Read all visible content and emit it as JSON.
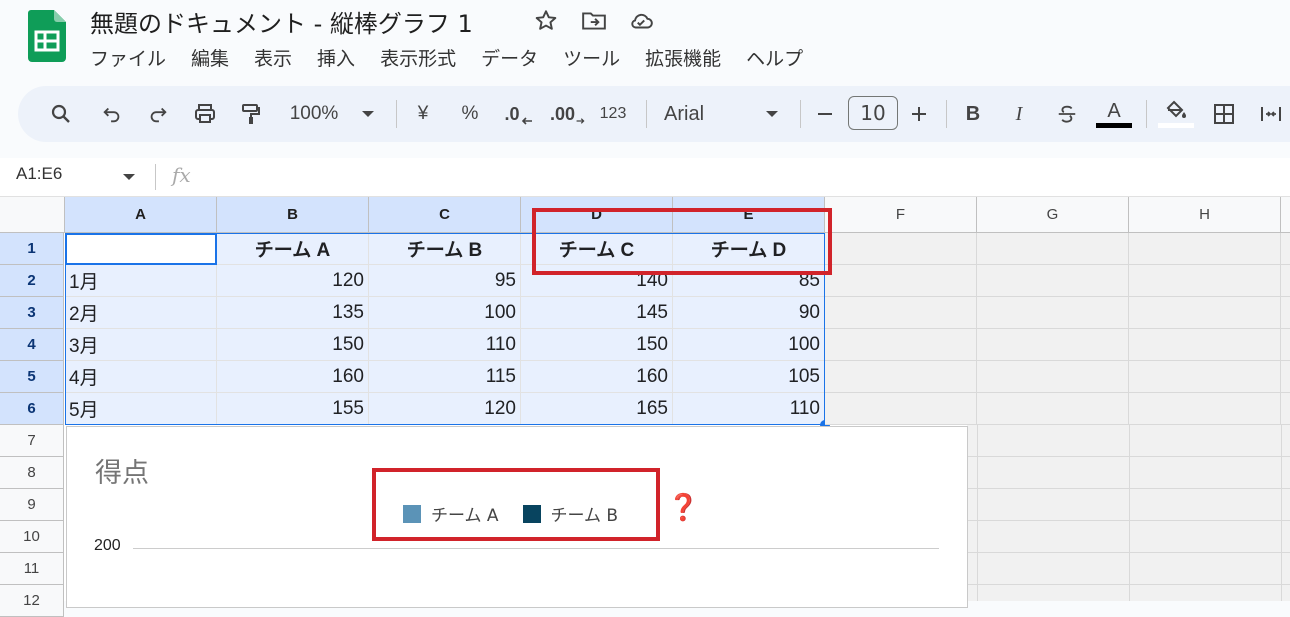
{
  "document": {
    "title": "無題のドキュメント - 縦棒グラフ 1",
    "menu": [
      "ファイル",
      "編集",
      "表示",
      "挿入",
      "表示形式",
      "データ",
      "ツール",
      "拡張機能",
      "ヘルプ"
    ]
  },
  "toolbar": {
    "zoom": "100%",
    "currency": "¥",
    "percent": "%",
    "decrease_decimal": ".0",
    "increase_decimal": ".00",
    "number_format": "123",
    "font": "Arial",
    "font_size": "10",
    "bold": "B",
    "italic": "I",
    "text_color_letter": "A"
  },
  "formula_bar": {
    "name_box": "A1:E6",
    "fx": "fx"
  },
  "columns": [
    "A",
    "B",
    "C",
    "D",
    "E",
    "F",
    "G",
    "H"
  ],
  "rows": [
    "1",
    "2",
    "3",
    "4",
    "5",
    "6",
    "7",
    "8",
    "9",
    "10",
    "11",
    "12"
  ],
  "table": {
    "headers": [
      "",
      "チーム A",
      "チーム B",
      "チーム C",
      "チーム D"
    ],
    "data": [
      [
        "1月",
        "120",
        "95",
        "140",
        "85"
      ],
      [
        "2月",
        "135",
        "100",
        "145",
        "90"
      ],
      [
        "3月",
        "150",
        "110",
        "150",
        "100"
      ],
      [
        "4月",
        "160",
        "115",
        "160",
        "105"
      ],
      [
        "5月",
        "155",
        "120",
        "165",
        "110"
      ]
    ]
  },
  "chart": {
    "title": "得点",
    "legend": [
      {
        "name": "チーム A",
        "color": "#5b93b7"
      },
      {
        "name": "チーム B",
        "color": "#08445f"
      }
    ],
    "y_tick": "200",
    "annotation": "❓"
  },
  "colors": {
    "accent": "#0b57d0",
    "highlight": "#d1232a",
    "selection": "#e8f0fe"
  },
  "icons": [
    "sheets-logo",
    "star-icon",
    "move-folder-icon",
    "cloud-saved-icon",
    "search-icon",
    "undo-icon",
    "redo-icon",
    "print-icon",
    "paint-format-icon",
    "dropdown-icon",
    "minus-icon",
    "plus-icon",
    "strikethrough-icon",
    "fill-color-icon",
    "borders-icon",
    "merge-icon"
  ]
}
